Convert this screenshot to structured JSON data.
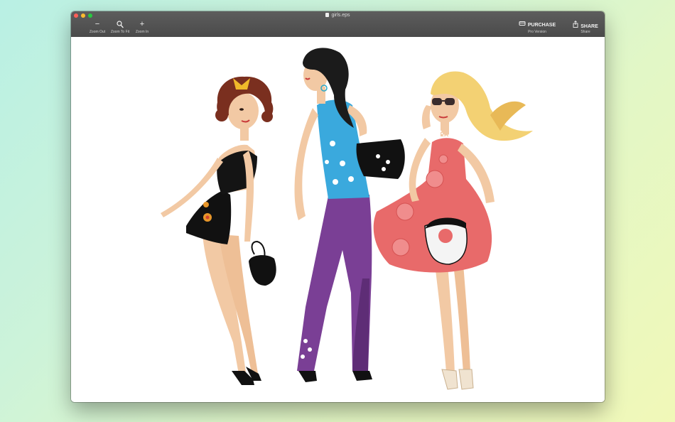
{
  "window": {
    "title": "girls.eps"
  },
  "toolbar": {
    "zoom_out": {
      "glyph": "−",
      "label": "Zoom Out"
    },
    "zoom_fit": {
      "glyph": "⚲",
      "label": "Zoom To Fit"
    },
    "zoom_in": {
      "glyph": "+",
      "label": "Zoom In"
    },
    "purchase": {
      "label": "PURCHASE",
      "sublabel": "Pro Version"
    },
    "share": {
      "label": "SHARE",
      "sublabel": "Share"
    }
  },
  "image": {
    "subject": "three fashion girls illustration",
    "colors": {
      "dress_red": "#e86a6a",
      "pants_purple": "#7a3f95",
      "top_cyan": "#3aa9dd",
      "skin": "#f2c9a4",
      "hair_brown": "#7a2f1f",
      "hair_black": "#1b1b1b",
      "hair_blonde": "#f3d173"
    }
  }
}
